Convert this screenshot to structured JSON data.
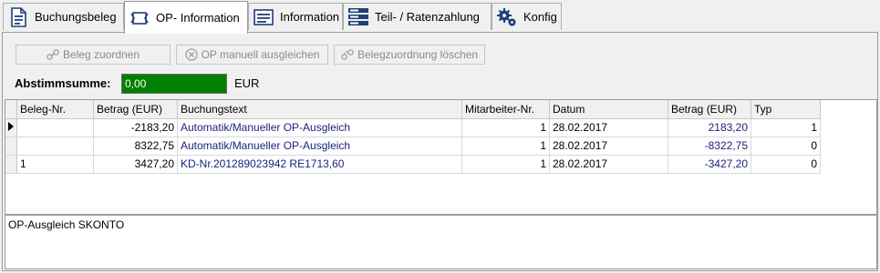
{
  "tabs": [
    {
      "label": "Buchungsbeleg",
      "icon": "document-icon"
    },
    {
      "label": "OP- Information",
      "icon": "op-info-icon"
    },
    {
      "label": "Information",
      "icon": "info-list-icon"
    },
    {
      "label": "Teil- / Ratenzahlung",
      "icon": "installment-icon"
    },
    {
      "label": "Konfig",
      "icon": "gear-icon"
    }
  ],
  "active_tab": "OP- Information",
  "toolbar": {
    "assign_label": "Beleg zuordnen",
    "manual_label": "OP manuell ausgleichen",
    "delete_label": "Belegzuordnung löschen"
  },
  "abstimmsumme": {
    "label": "Abstimmsumme:",
    "value": "0,00",
    "unit": "EUR",
    "field_color": "#008000"
  },
  "grid": {
    "columns": [
      "Beleg-Nr.",
      "Betrag (EUR)",
      "Buchungstext",
      "Mitarbeiter-Nr.",
      "Datum",
      "Betrag (EUR)",
      "Typ"
    ],
    "rows": [
      {
        "beleg": "",
        "betrag": "-2183,20",
        "text": "Automatik/Manueller OP-Ausgleich",
        "mitarbeiter": "1",
        "datum": "28.02.2017",
        "betrag2": "2183,20",
        "typ": "1",
        "current": true
      },
      {
        "beleg": "",
        "betrag": "8322,75",
        "text": "Automatik/Manueller OP-Ausgleich",
        "mitarbeiter": "1",
        "datum": "28.02.2017",
        "betrag2": "-8322,75",
        "typ": "0",
        "current": false
      },
      {
        "beleg": "1",
        "betrag": "3427,20",
        "text": "KD-Nr.201289023942 RE1713,60",
        "mitarbeiter": "1",
        "datum": "28.02.2017",
        "betrag2": "-3427,20",
        "typ": "0",
        "current": false
      }
    ]
  },
  "note": "OP-Ausgleich SKONTO"
}
